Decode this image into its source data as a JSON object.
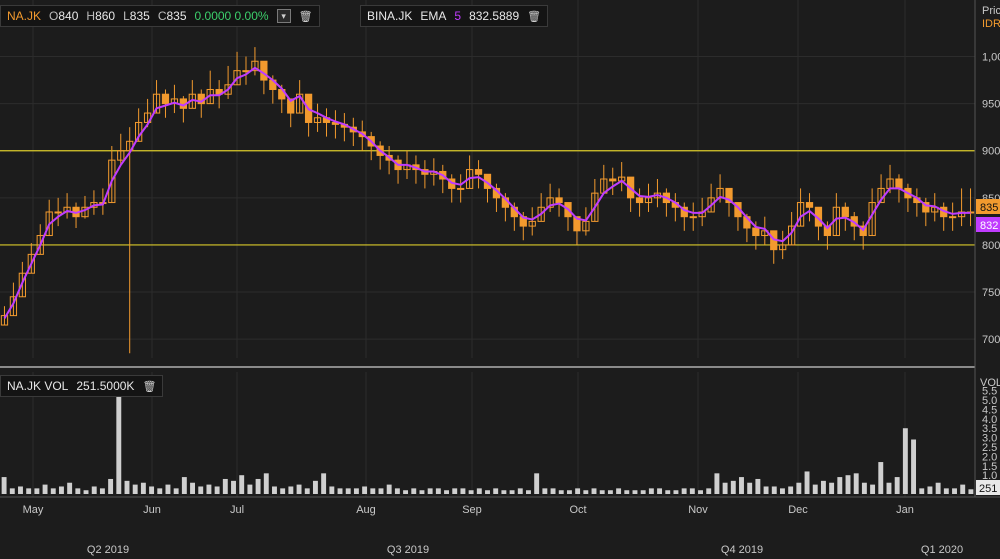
{
  "price_legend": {
    "symbol": "NA.JK",
    "open_label": "O",
    "open_value": "840",
    "high_label": "H",
    "high_value": "860",
    "low_label": "L",
    "low_value": "835",
    "close_label": "C",
    "close_value": "835",
    "change": "0.0000 0.00%"
  },
  "ema_legend": {
    "symbol": "BINA.JK",
    "label": "EMA",
    "length": "5",
    "value": "832.5889"
  },
  "volume_legend": {
    "label": "NA.JK VOL",
    "value": "251.5000K"
  },
  "price_axis": {
    "title": "Pric",
    "currency": "IDR",
    "last_badge": "835",
    "ema_badge": "832",
    "badge_color": "#f29a2e",
    "ema_color": "#c03cff"
  },
  "volume_axis": {
    "title": "VOL",
    "last_badge": "251"
  },
  "colors": {
    "background": "#1c1c1c",
    "candle": "#f29a2e",
    "ema": "#c03cff",
    "level_lines": "#d9c82a",
    "volume": "#cfcfcf"
  },
  "chart_data": [
    {
      "type": "candlestick",
      "symbol": "BINA.JK",
      "ylim": [
        680,
        1060
      ],
      "yticks": [
        700,
        750,
        800,
        850,
        900,
        950,
        1000
      ],
      "ytick_labels": [
        "700",
        "750",
        "800",
        "850",
        "900",
        "950",
        "1,00"
      ],
      "horizontal_lines": [
        900,
        800
      ],
      "x_month_labels": [
        "May",
        "Jun",
        "Jul",
        "Aug",
        "Sep",
        "Oct",
        "Nov",
        "Dec",
        "Jan"
      ],
      "x_quarter_labels": [
        "Q2 2019",
        "Q3 2019",
        "Q4 2019",
        "Q1 2020"
      ],
      "close": [
        725,
        745,
        770,
        790,
        810,
        835,
        835,
        840,
        830,
        840,
        845,
        845,
        890,
        900,
        910,
        930,
        940,
        960,
        950,
        955,
        945,
        960,
        950,
        965,
        960,
        970,
        985,
        985,
        995,
        975,
        965,
        955,
        940,
        960,
        930,
        935,
        930,
        928,
        925,
        920,
        915,
        905,
        895,
        890,
        880,
        885,
        880,
        875,
        878,
        870,
        860,
        860,
        880,
        875,
        860,
        850,
        840,
        830,
        820,
        825,
        840,
        850,
        845,
        830,
        815,
        825,
        855,
        870,
        868,
        872,
        850,
        845,
        850,
        855,
        845,
        840,
        830,
        830,
        835,
        850,
        860,
        845,
        830,
        818,
        810,
        815,
        795,
        800,
        820,
        845,
        840,
        820,
        810,
        840,
        830,
        820,
        810,
        845,
        860,
        870,
        860,
        850,
        845,
        835,
        840,
        830,
        830,
        835,
        835
      ],
      "high": [
        735,
        760,
        782,
        802,
        822,
        848,
        850,
        855,
        845,
        852,
        858,
        860,
        905,
        918,
        925,
        945,
        955,
        975,
        965,
        970,
        958,
        975,
        965,
        985,
        975,
        990,
        1005,
        1000,
        1010,
        990,
        980,
        970,
        955,
        975,
        945,
        950,
        945,
        943,
        940,
        935,
        932,
        920,
        910,
        905,
        895,
        900,
        895,
        890,
        892,
        885,
        875,
        875,
        895,
        890,
        875,
        865,
        855,
        845,
        835,
        840,
        855,
        865,
        860,
        845,
        830,
        840,
        870,
        885,
        882,
        888,
        865,
        860,
        865,
        870,
        860,
        855,
        845,
        845,
        850,
        865,
        875,
        860,
        845,
        833,
        825,
        830,
        810,
        815,
        835,
        860,
        855,
        835,
        825,
        855,
        845,
        835,
        825,
        860,
        875,
        885,
        875,
        865,
        860,
        850,
        855,
        845,
        845,
        860,
        860
      ],
      "low": [
        715,
        735,
        758,
        778,
        798,
        822,
        820,
        828,
        818,
        828,
        832,
        832,
        875,
        885,
        895,
        915,
        925,
        945,
        935,
        940,
        930,
        945,
        935,
        950,
        945,
        955,
        970,
        970,
        980,
        960,
        950,
        940,
        925,
        945,
        915,
        920,
        915,
        913,
        910,
        905,
        900,
        890,
        880,
        875,
        865,
        870,
        865,
        860,
        863,
        855,
        845,
        845,
        865,
        860,
        845,
        835,
        825,
        815,
        805,
        810,
        825,
        835,
        830,
        815,
        800,
        810,
        840,
        855,
        853,
        857,
        835,
        830,
        835,
        840,
        830,
        825,
        815,
        815,
        820,
        835,
        845,
        830,
        815,
        803,
        795,
        800,
        780,
        785,
        805,
        830,
        825,
        805,
        795,
        825,
        815,
        805,
        795,
        830,
        845,
        855,
        845,
        835,
        830,
        820,
        825,
        815,
        815,
        820,
        820
      ],
      "ema_5": [
        722,
        738,
        760,
        780,
        800,
        822,
        830,
        836,
        834,
        837,
        842,
        843,
        868,
        885,
        898,
        915,
        928,
        945,
        948,
        951,
        948,
        954,
        952,
        959,
        959,
        965,
        977,
        981,
        988,
        982,
        975,
        966,
        953,
        958,
        944,
        940,
        935,
        931,
        928,
        923,
        918,
        910,
        900,
        893,
        885,
        885,
        882,
        878,
        878,
        874,
        866,
        864,
        871,
        872,
        866,
        858,
        849,
        839,
        829,
        827,
        833,
        842,
        844,
        838,
        828,
        826,
        840,
        855,
        862,
        868,
        860,
        852,
        851,
        853,
        850,
        845,
        837,
        834,
        834,
        842,
        851,
        848,
        840,
        829,
        819,
        817,
        806,
        804,
        813,
        830,
        836,
        828,
        818,
        828,
        829,
        824,
        816,
        832,
        848,
        860,
        860,
        855,
        850,
        842,
        841,
        836,
        833,
        834,
        834
      ]
    },
    {
      "type": "bar",
      "series_name": "NA.JK VOL",
      "unit": "M",
      "ylim": [
        0,
        5.8
      ],
      "yticks": [
        1.0,
        1.5,
        2.0,
        2.5,
        3.0,
        3.5,
        4.0,
        4.5,
        5.0,
        5.5
      ],
      "ytick_labels": [
        "1.0",
        "1.5",
        "2.0",
        "2.5",
        "3.0",
        "3.5",
        "4.0",
        "4.5",
        "5.0",
        "5.5"
      ],
      "values": [
        0.9,
        0.3,
        0.4,
        0.3,
        0.3,
        0.5,
        0.3,
        0.4,
        0.6,
        0.3,
        0.2,
        0.4,
        0.3,
        0.8,
        5.2,
        0.7,
        0.5,
        0.6,
        0.4,
        0.3,
        0.5,
        0.3,
        0.9,
        0.6,
        0.4,
        0.5,
        0.4,
        0.8,
        0.7,
        1.0,
        0.5,
        0.8,
        1.1,
        0.4,
        0.3,
        0.4,
        0.5,
        0.3,
        0.7,
        1.1,
        0.4,
        0.3,
        0.3,
        0.3,
        0.4,
        0.3,
        0.3,
        0.5,
        0.3,
        0.2,
        0.3,
        0.2,
        0.3,
        0.3,
        0.2,
        0.3,
        0.3,
        0.2,
        0.3,
        0.2,
        0.3,
        0.2,
        0.2,
        0.3,
        0.2,
        1.1,
        0.3,
        0.3,
        0.2,
        0.2,
        0.3,
        0.2,
        0.3,
        0.2,
        0.2,
        0.3,
        0.2,
        0.2,
        0.2,
        0.3,
        0.3,
        0.2,
        0.2,
        0.3,
        0.3,
        0.2,
        0.3,
        1.1,
        0.6,
        0.7,
        0.9,
        0.6,
        0.8,
        0.4,
        0.4,
        0.3,
        0.4,
        0.6,
        1.2,
        0.5,
        0.7,
        0.6,
        0.9,
        1.0,
        1.1,
        0.6,
        0.5,
        1.7,
        0.6,
        0.9,
        3.5,
        2.9,
        0.3,
        0.4,
        0.6,
        0.3,
        0.3,
        0.5,
        0.25
      ]
    }
  ]
}
